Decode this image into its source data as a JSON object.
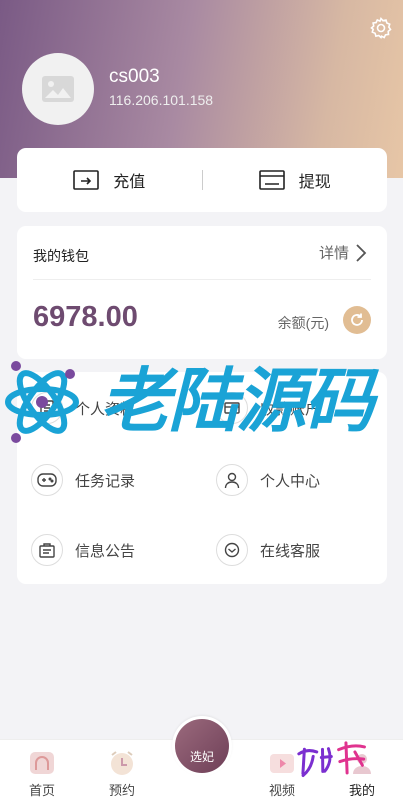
{
  "profile": {
    "username": "cs003",
    "ip": "116.206.101.158"
  },
  "actions": {
    "recharge": "充值",
    "withdraw": "提现"
  },
  "wallet": {
    "title": "我的钱包",
    "detail": "详情",
    "balance": "6978.00",
    "balance_label": "余额(元)"
  },
  "menu": {
    "items": [
      {
        "label": "个人资料",
        "icon": "profile-icon"
      },
      {
        "label": "收款账户",
        "icon": "account-icon"
      },
      {
        "label": "任务记录",
        "icon": "gamepad-icon"
      },
      {
        "label": "个人中心",
        "icon": "person-icon"
      },
      {
        "label": "信息公告",
        "icon": "notice-icon"
      },
      {
        "label": "在线客服",
        "icon": "support-icon"
      }
    ]
  },
  "watermark": {
    "text": "老陆源码"
  },
  "tabbar": {
    "tabs": [
      "首页",
      "预约",
      "选妃",
      "视频",
      "我的"
    ]
  },
  "colors": {
    "balance": "#6e4b70",
    "accent": "#e1bd93",
    "watermark": "#1aa3d6"
  }
}
